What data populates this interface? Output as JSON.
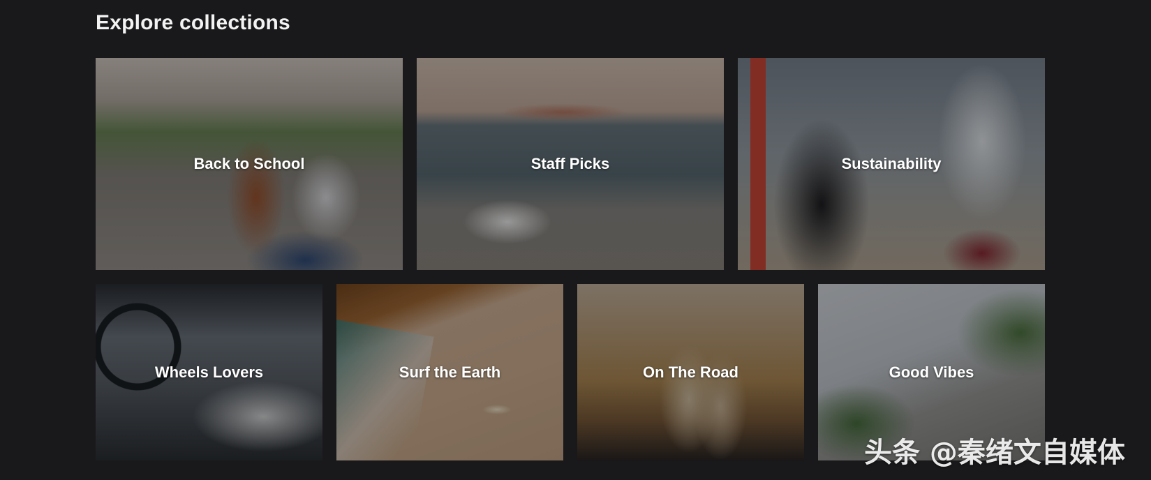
{
  "page": {
    "title": "Explore collections"
  },
  "collections": [
    {
      "label": "Back to School"
    },
    {
      "label": "Staff Picks"
    },
    {
      "label": "Sustainability"
    },
    {
      "label": "Wheels Lovers"
    },
    {
      "label": "Surf the Earth"
    },
    {
      "label": "On The Road"
    },
    {
      "label": "Good Vibes"
    }
  ],
  "watermark": {
    "text": "头条 @秦绪文自媒体"
  }
}
